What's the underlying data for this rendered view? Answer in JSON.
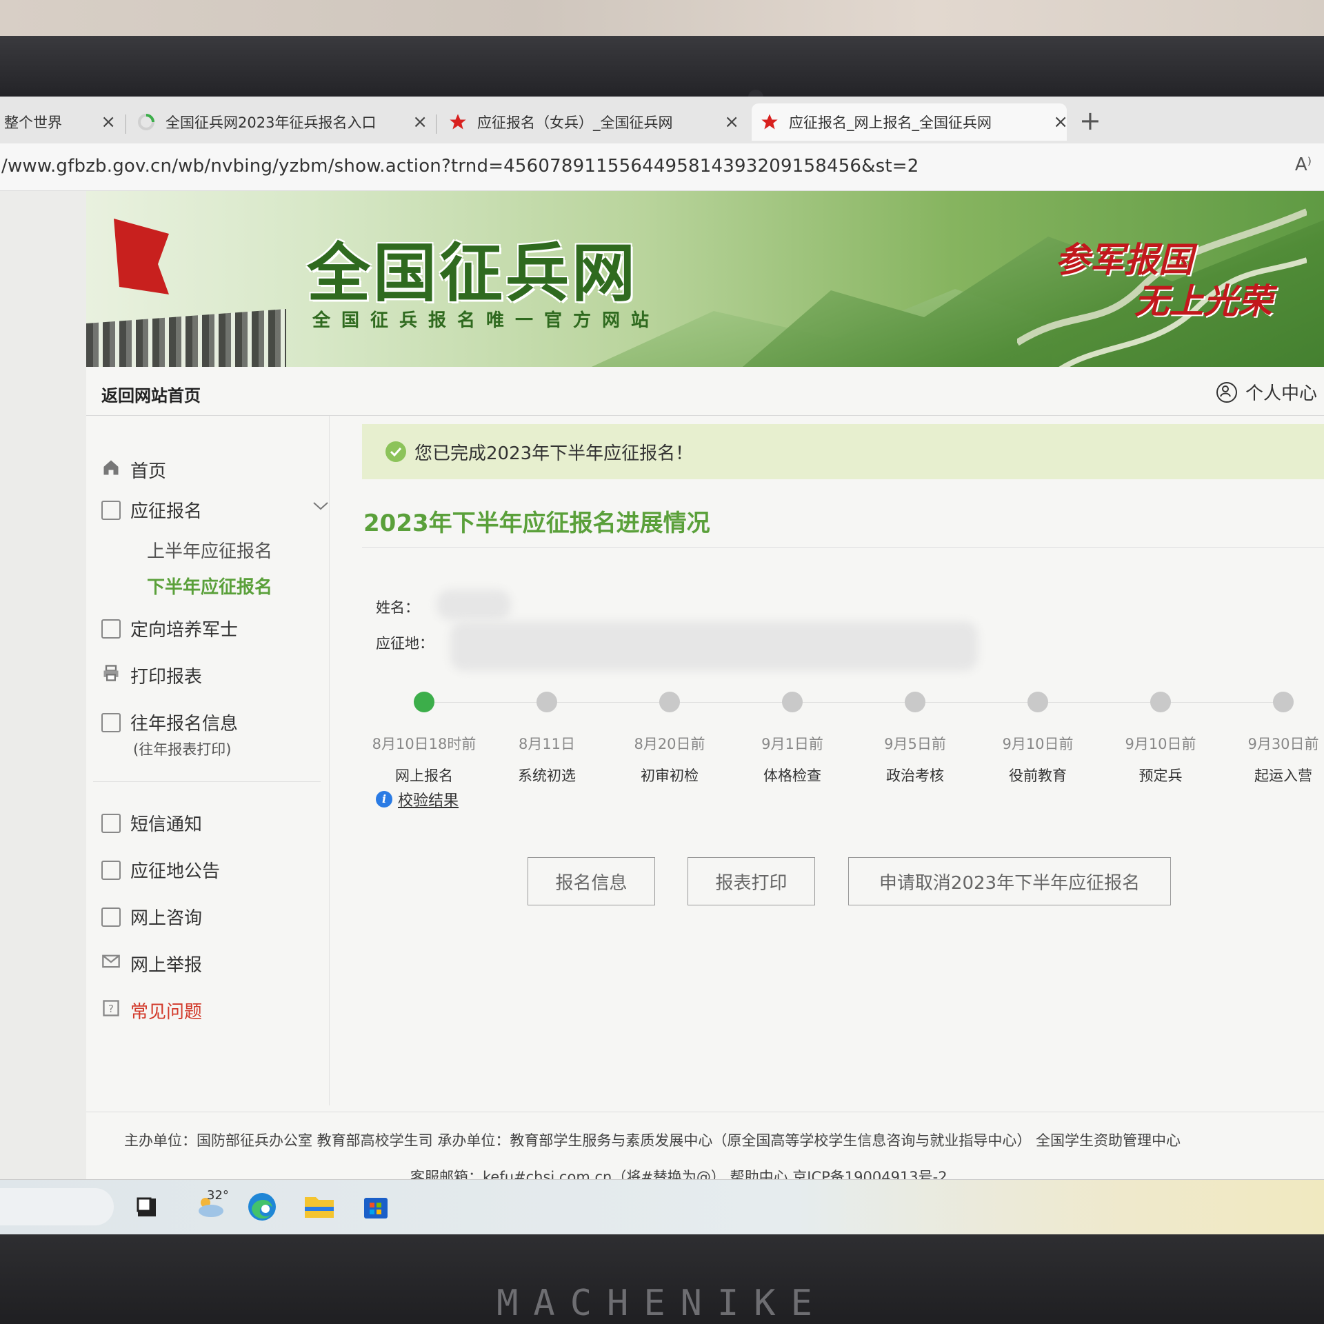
{
  "browser": {
    "tabs": [
      {
        "title": "整个世界"
      },
      {
        "title": "全国征兵网2023年征兵报名入口"
      },
      {
        "title": "应征报名（女兵）_全国征兵网"
      },
      {
        "title": "应征报名_网上报名_全国征兵网"
      }
    ],
    "close_glyph": "×",
    "new_tab_glyph": "+",
    "url": "/www.gfbzb.gov.cn/wb/nvbing/yzbm/show.action?trnd=4560789115564495814393209158456&st=2",
    "read_aloud_glyph": "A⁾"
  },
  "header": {
    "site_title": "全国征兵网",
    "site_subtitle": "全国征兵报名唯一官方网站",
    "slogan_top": "参军报国",
    "slogan_bottom": "无上光荣"
  },
  "nav": {
    "back_home": "返回网站首页",
    "user_center": "个人中心"
  },
  "sidebar": {
    "home": "首页",
    "enlist": "应征报名",
    "enlist_sub": [
      "上半年应征报名",
      "下半年应征报名"
    ],
    "directed_training": "定向培养军士",
    "print_forms": "打印报表",
    "past_info": "往年报名信息",
    "past_info_note": "(往年报表打印)",
    "sms": "短信通知",
    "announcements": "应征地公告",
    "consult": "网上咨询",
    "report": "网上举报",
    "faq": "常见问题"
  },
  "main": {
    "success_message": "您已完成2023年下半年应征报名！",
    "section_title": "2023年下半年应征报名进展情况",
    "name_label": "姓名：",
    "location_label": "应征地：",
    "steps": [
      {
        "date": "8月10日18时前",
        "name": "网上报名",
        "done": true
      },
      {
        "date": "8月11日",
        "name": "系统初选",
        "done": false
      },
      {
        "date": "8月20日前",
        "name": "初审初检",
        "done": false
      },
      {
        "date": "9月1日前",
        "name": "体格检查",
        "done": false
      },
      {
        "date": "9月5日前",
        "name": "政治考核",
        "done": false
      },
      {
        "date": "9月10日前",
        "name": "役前教育",
        "done": false
      },
      {
        "date": "9月10日前",
        "name": "预定兵",
        "done": false
      },
      {
        "date": "9月30日前",
        "name": "起运入营",
        "done": false
      }
    ],
    "verify_link": "校验结果",
    "buttons": {
      "info": "报名信息",
      "print": "报表打印",
      "cancel": "申请取消2023年下半年应征报名"
    }
  },
  "footer": {
    "line1": "主办单位：国防部征兵办公室   教育部高校学生司    承办单位：教育部学生服务与素质发展中心（原全国高等学校学生信息咨询与就业指导中心）   全国学生资助管理中心",
    "line2": "客服邮箱：kefu#chsi.com.cn（将#替换为@）    帮助中心    京ICP备19004913号-2"
  },
  "taskbar": {
    "weather_temp": "32°"
  },
  "monitor": {
    "brand": "MACHENIKE"
  },
  "colors": {
    "accent_green": "#5aa03a",
    "step_done": "#3cae4a",
    "faq_red": "#d23a2b",
    "info_blue": "#2a7be4"
  }
}
